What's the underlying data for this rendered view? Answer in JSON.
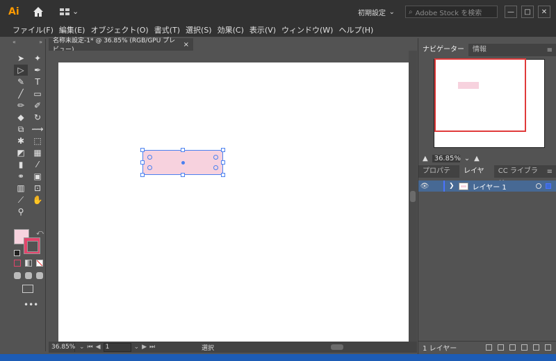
{
  "titlebar": {
    "logo": "Ai",
    "preset": "初期設定",
    "search_placeholder": "Adobe Stock を検索",
    "win_minimize": "—",
    "win_maximize": "□",
    "win_close": "✕"
  },
  "menu": [
    "ファイル(F)",
    "編集(E)",
    "オブジェクト(O)",
    "書式(T)",
    "選択(S)",
    "効果(C)",
    "表示(V)",
    "ウィンドウ(W)",
    "ヘルプ(H)"
  ],
  "toolbar": {
    "collapse_left": "«",
    "collapse_right": "»",
    "more": "•••"
  },
  "document": {
    "tab_title": "名称未設定-1* @ 36.85% (RGB/GPU プレビュー)",
    "tab_close": "×",
    "shape_fill": "#f7d2de",
    "selection_color": "#4a80f0"
  },
  "status": {
    "zoom": "36.85%",
    "artboard_number": "1",
    "tool_label": "選択"
  },
  "navigator": {
    "tab1": "ナビゲーター",
    "tab2": "情報",
    "zoom": "36.85%"
  },
  "layers_panel": {
    "tab1": "プロパティ",
    "tab2": "レイヤー",
    "tab3": "CC ライブラリ",
    "layer_name": "レイヤー 1",
    "footer_count": "1 レイヤー"
  },
  "colors": {
    "fill": "#f7d2de",
    "stroke": "#e3446b",
    "nav_view": "#e03a3a",
    "layer_highlight": "#476994"
  }
}
